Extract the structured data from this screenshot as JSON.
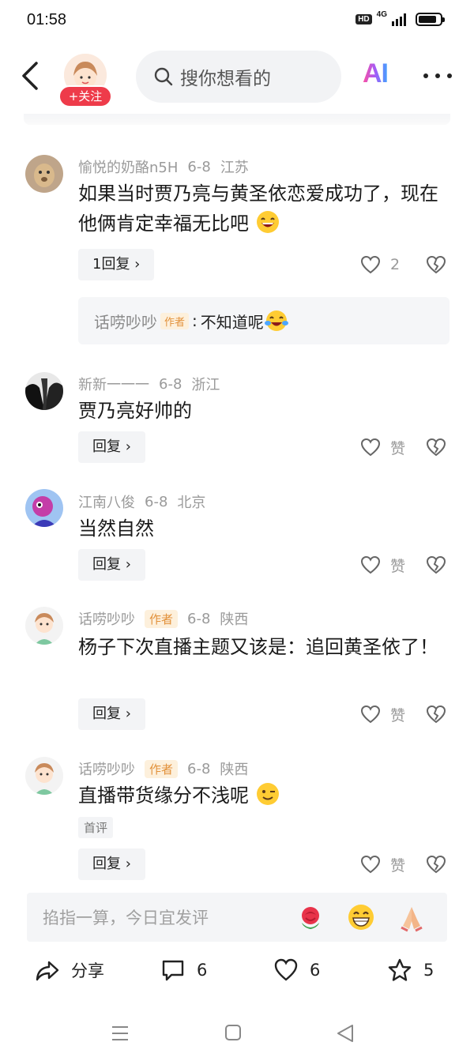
{
  "status_bar": {
    "time": "01:58",
    "hd_label": "HD",
    "network_label": "4G",
    "battery_level": 0.85
  },
  "nav": {
    "follow_label": "+关注",
    "search_placeholder": "搜你想看的",
    "ai_label": "AI"
  },
  "comments": [
    {
      "user": "愉悦的奶酪n5H",
      "is_author": false,
      "date": "6-8",
      "location": "江苏",
      "text": "如果当时贾乃亮与黄圣依恋爱成功了，现在他俩肯定幸福无比吧",
      "emoji": "grinning-emoji",
      "reply_label": "1回复",
      "like_count": "2"
    },
    {
      "user": "新新一一一",
      "is_author": false,
      "date": "6-8",
      "location": "浙江",
      "text": "贾乃亮好帅的",
      "reply_label": "回复",
      "like_label": "赞"
    },
    {
      "user": "江南八俊",
      "is_author": false,
      "date": "6-8",
      "location": "北京",
      "text": "当然自然",
      "reply_label": "回复",
      "like_label": "赞"
    },
    {
      "user": "话唠吵吵",
      "is_author": true,
      "date": "6-8",
      "location": "陕西",
      "text": "杨子下次直播主题又该是：追回黄圣依了！",
      "reply_label": "回复",
      "like_label": "赞"
    },
    {
      "user": "话唠吵吵",
      "is_author": true,
      "date": "6-8",
      "location": "陕西",
      "text": "直播带货缘分不浅呢",
      "emoji": "winking-emoji",
      "first_tag": "首评",
      "reply_label": "回复",
      "like_label": "赞"
    }
  ],
  "author_tag": "作者",
  "sub_reply": {
    "user": "话唠吵吵",
    "tag": "作者",
    "text": "不知道呢",
    "emoji": "tears-of-joy-emoji"
  },
  "input_bar": {
    "placeholder": "掐指一算，今日宜发评",
    "quick_emojis": [
      "rose-emoji",
      "beaming-emoji",
      "praying-hands-emoji"
    ]
  },
  "actions": {
    "share_label": "分享",
    "comment_count": "6",
    "like_count": "6",
    "favorite_count": "5"
  },
  "colors": {
    "follow_red": "#ee3b4a",
    "author_tag_bg": "#fdf0dc",
    "author_tag_text": "#e2913b"
  }
}
